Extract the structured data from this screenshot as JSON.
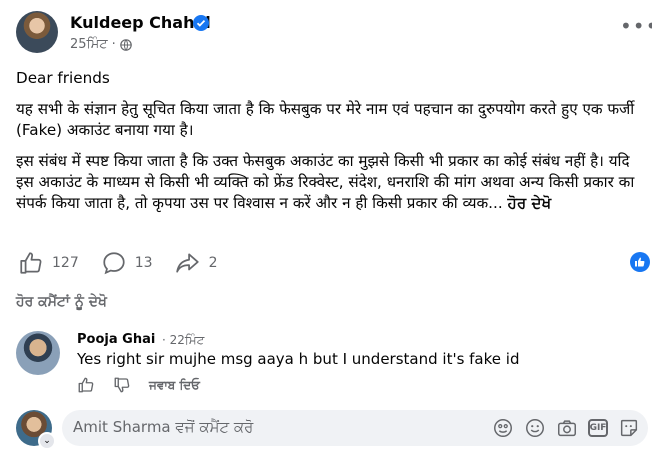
{
  "post": {
    "author": "Kuldeep Chahal",
    "time": "25ਮਿੰਟ",
    "greeting": "Dear friends",
    "para1": "यह सभी के संज्ञान हेतु सूचित किया जाता है कि फेसबुक पर मेरे नाम एवं पहचान का दुरुपयोग करते हुए एक फर्जी (Fake) अकाउंट बनाया गया है।",
    "para2": "इस संबंध में स्पष्ट किया जाता है कि उक्त फेसबुक अकाउंट का मुझसे किसी भी प्रकार का कोई संबंध नहीं है। यदि इस अकाउंट के माध्यम से किसी भी व्यक्ति को फ्रेंड रिक्वेस्ट, संदेश, धनराशि की मांग अथवा अन्य किसी प्रकार का संपर्क किया जाता है, तो कृपया उस पर विश्वास न करें और न ही किसी प्रकार की व्यक...",
    "see_more": "ਹੋਰ ਦੇਖੋ",
    "likes": "127",
    "comments": "13",
    "shares": "2"
  },
  "view_more_comments": "ਹੋਰ ਕਮੈਂਟਾਂ ਨੂੰ ਦੇਖੋ",
  "comment": {
    "author": "Pooja Ghai",
    "separator": "·",
    "time": "22ਮਿੰਟ",
    "text": "Yes right sir mujhe msg aaya h but I understand it's fake id",
    "reply_label": "ਜਵਾਬ ਦਿਓ"
  },
  "composer": {
    "placeholder": "Amit Sharma ਵਜੋਂ ਕਮੈਂਟ ਕਰੋ",
    "gif_label": "GIF"
  },
  "colors": {
    "accent": "#1877f2",
    "secondary_text": "#65676b",
    "input_bg": "#f0f2f5"
  }
}
